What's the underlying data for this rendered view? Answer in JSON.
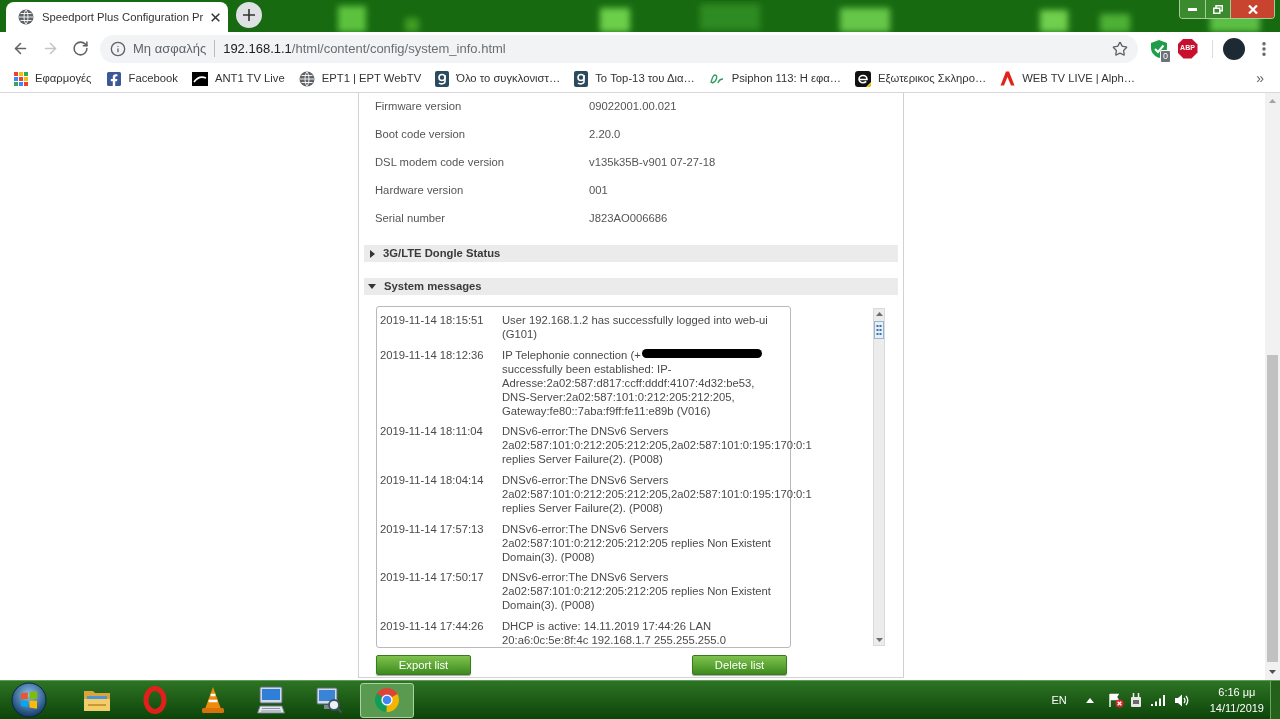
{
  "browser": {
    "tabs": [
      {
        "title": "Speedport Plus Configuration Pr",
        "selected": true
      }
    ],
    "nav_buttons": [
      {
        "kind": "back",
        "disabled": false
      },
      {
        "kind": "forward",
        "disabled": true
      },
      {
        "kind": "reload",
        "disabled": false
      }
    ],
    "address_bar": {
      "security_label": "Μη ασφαλής",
      "host": "192.168.1.1",
      "path": "/html/content/config/system_info.html"
    },
    "extensions": [
      {
        "kind": "shield",
        "badge": "0"
      },
      {
        "kind": "abp",
        "label": "ABP"
      }
    ],
    "bookmarks": [
      {
        "kind": "apps",
        "label": "Εφαρμογές"
      },
      {
        "kind": "facebook",
        "label": "Facebook"
      },
      {
        "kind": "ant1",
        "label": "ANT1 TV Live"
      },
      {
        "kind": "globe",
        "label": "ΕΡΤ1 | ΕΡΤ WebTV"
      },
      {
        "kind": "g",
        "label": "Όλο το συγκλονιστ…"
      },
      {
        "kind": "g",
        "label": "Το Top-13 του Δια…"
      },
      {
        "kind": "dr",
        "label": "Psiphon 113: Η εφα…"
      },
      {
        "kind": "e",
        "label": "Εξωτερικος Σκληρο…"
      },
      {
        "kind": "alpha",
        "label": "WEB TV LIVE | Alph…"
      }
    ],
    "bookmarks_overflow": "»"
  },
  "page": {
    "device_info": [
      {
        "label": "Firmware version",
        "value": "09022001.00.021"
      },
      {
        "label": "Boot code version",
        "value": "2.20.0"
      },
      {
        "label": "DSL modem code version",
        "value": "v135k35B-v901 07-27-18"
      },
      {
        "label": "Hardware version",
        "value": "001"
      },
      {
        "label": "Serial number",
        "value": "J823AO006686"
      }
    ],
    "sections": [
      {
        "title": "3G/LTE Dongle Status",
        "expanded": false
      },
      {
        "title": "System messages",
        "expanded": true,
        "messages": [
          {
            "kind": "plain",
            "time": "2019-11-14 18:15:51",
            "text": "User 192.168.1.2 has successfully logged into web-ui (G101)"
          },
          {
            "kind": "redacted",
            "time": "2019-11-14 18:12:36",
            "text_before": "IP Telephonie connection (+",
            "text_after": "successfully been established: IP-Adresse:2a02:587:d817:ccff:dddf:4107:4d32:be53, DNS-Server:2a02:587:101:0:212:205:212:205, Gateway:fe80::7aba:f9ff:fe11:e89b (V016)"
          },
          {
            "kind": "plain",
            "time": "2019-11-14 18:11:04",
            "text": "DNSv6-error:The DNSv6 Servers 2a02:587:101:0:212:205:212:205,2a02:587:101:0:195:170:0:1 replies Server Failure(2). (P008)"
          },
          {
            "kind": "plain",
            "time": "2019-11-14 18:04:14",
            "text": "DNSv6-error:The DNSv6 Servers 2a02:587:101:0:212:205:212:205,2a02:587:101:0:195:170:0:1 replies Server Failure(2). (P008)"
          },
          {
            "kind": "plain",
            "time": "2019-11-14 17:57:13",
            "text": "DNSv6-error:The DNSv6 Servers 2a02:587:101:0:212:205:212:205 replies Non Existent Domain(3). (P008)"
          },
          {
            "kind": "plain",
            "time": "2019-11-14 17:50:17",
            "text": "DNSv6-error:The DNSv6 Servers 2a02:587:101:0:212:205:212:205 replies Non Existent Domain(3). (P008)"
          },
          {
            "kind": "plain",
            "time": "2019-11-14 17:44:26",
            "text": "DHCP is active: 14.11.2019 17:44:26 LAN 20:a6:0c:5e:8f:4c 192.168.1.7 255.255.255.0"
          }
        ],
        "buttons": [
          "Export list",
          "Delete list"
        ]
      }
    ]
  },
  "taskbar": {
    "apps": [
      {
        "kind": "explorer",
        "active": false
      },
      {
        "kind": "opera",
        "active": false
      },
      {
        "kind": "vlc",
        "active": false
      },
      {
        "kind": "keyboard_monitor",
        "active": false
      },
      {
        "kind": "monitor_search",
        "active": false
      },
      {
        "kind": "chrome",
        "active": true
      }
    ],
    "language": "EN",
    "clock": {
      "time": "6:16 μμ",
      "date": "14/11/2019"
    }
  }
}
